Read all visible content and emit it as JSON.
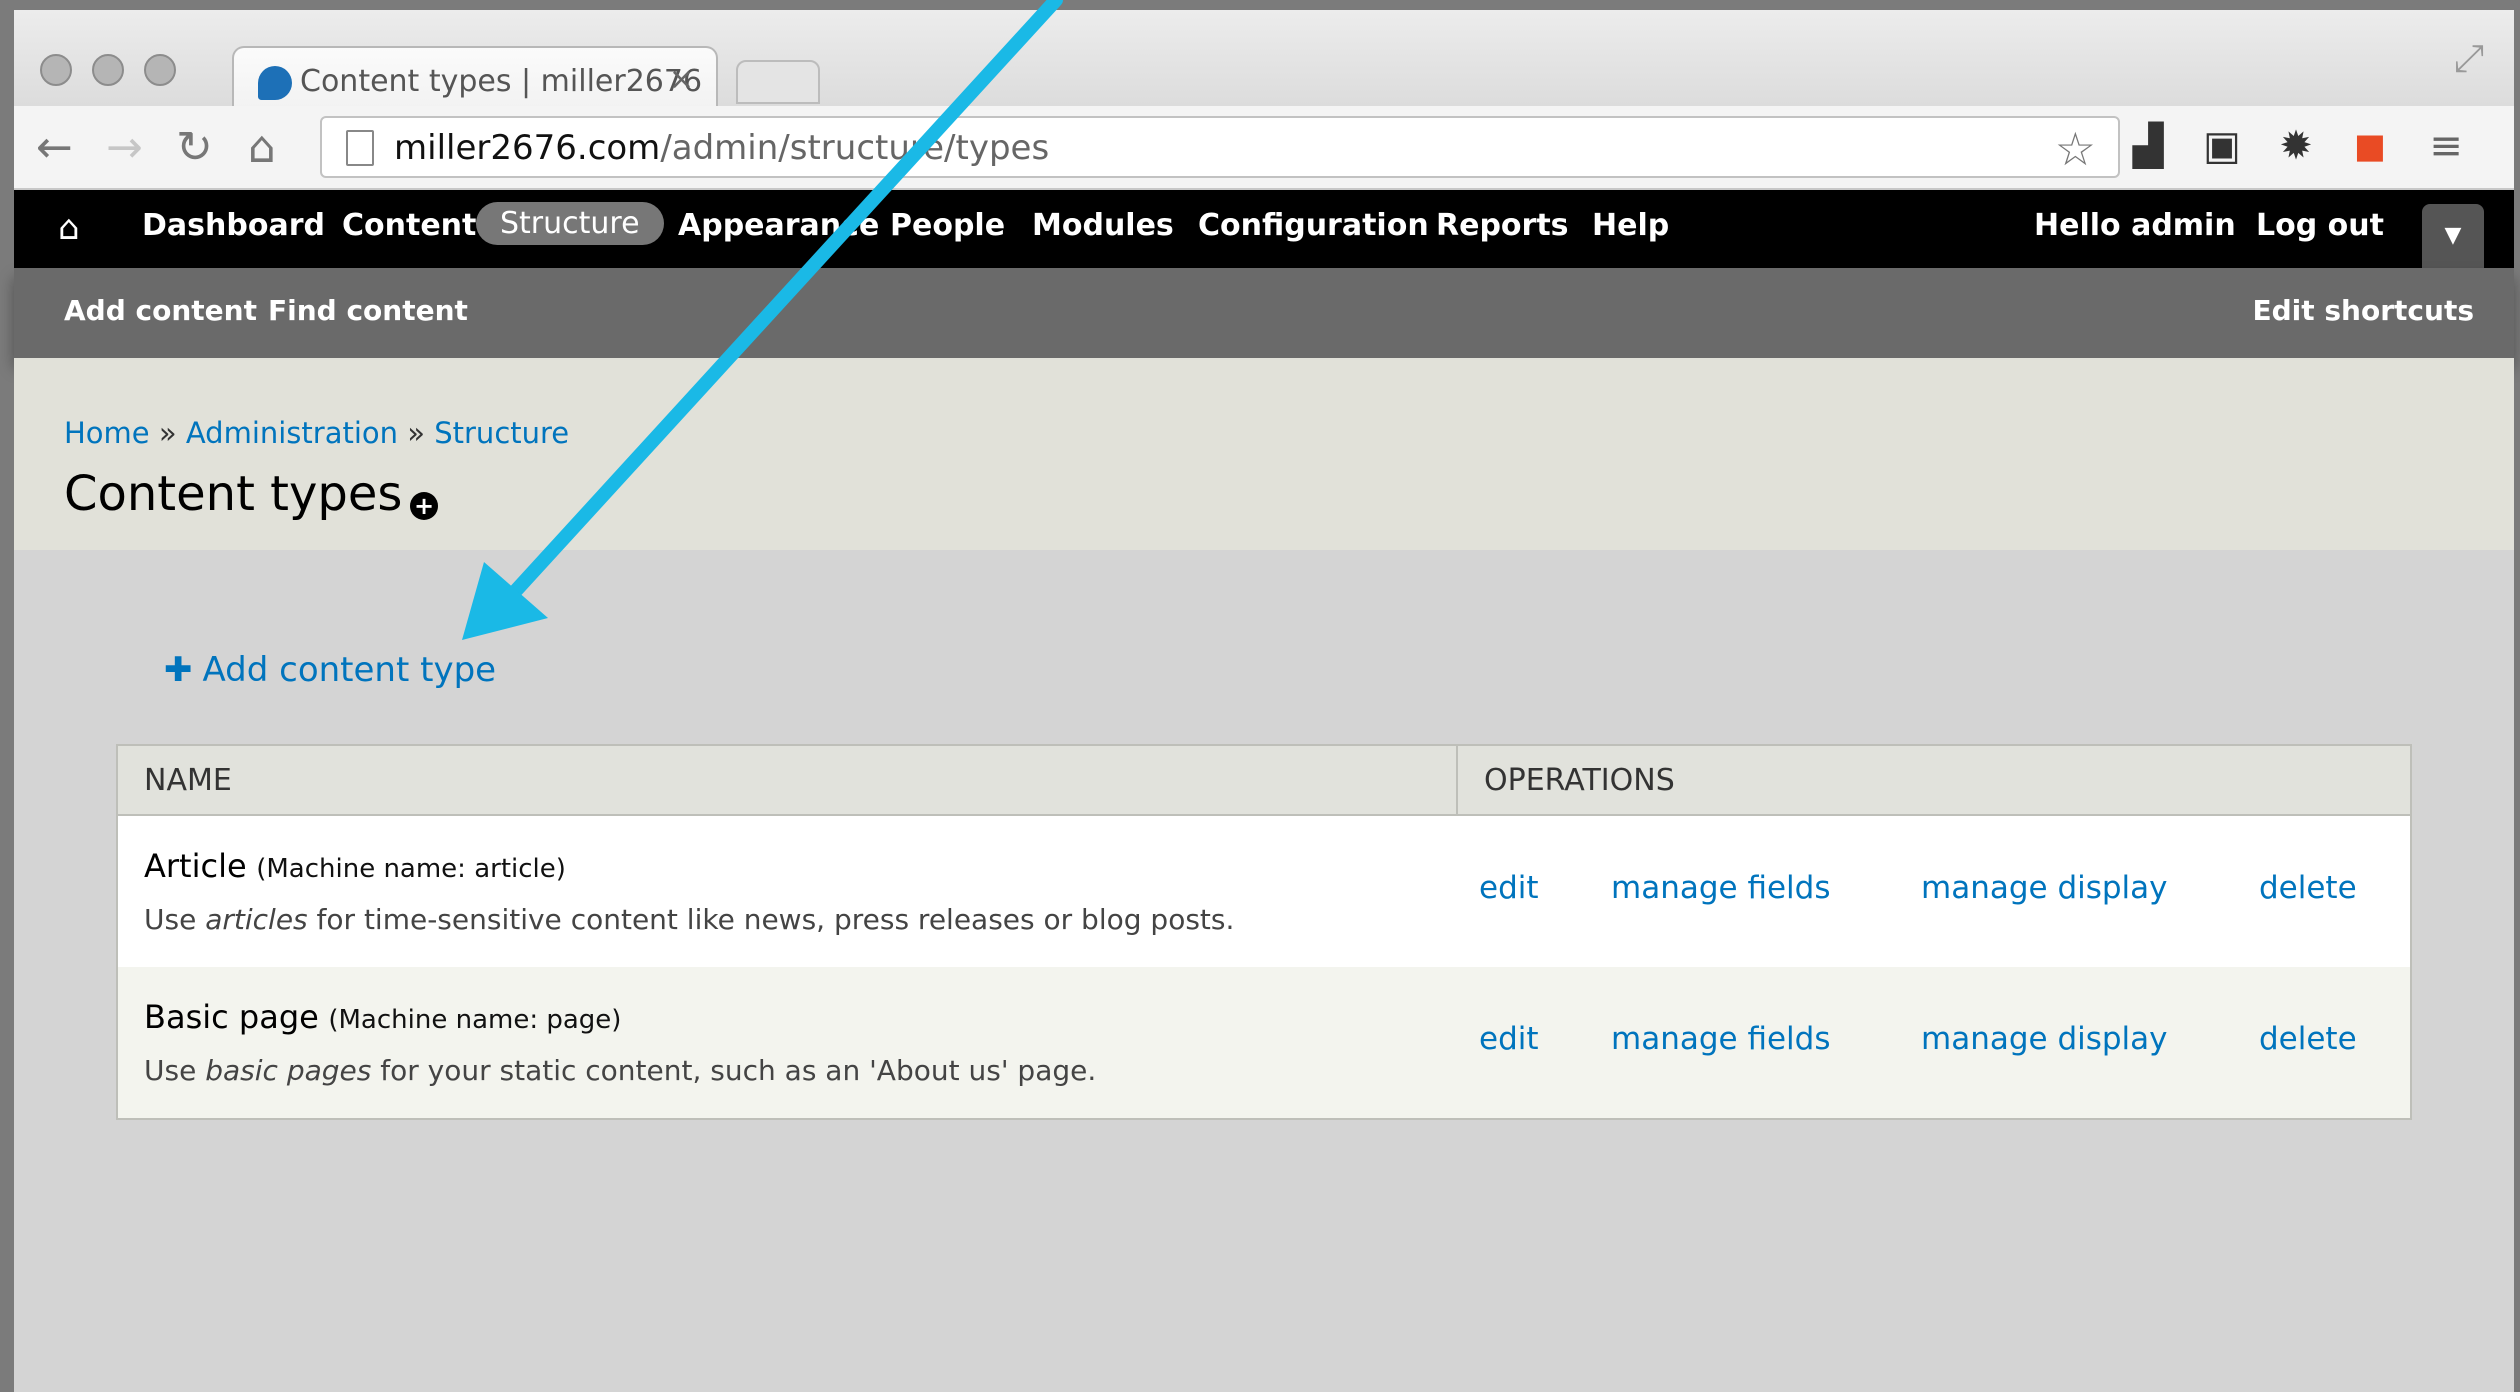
{
  "browser": {
    "tab_title": "Content types | miller2676",
    "tab_close": "×",
    "url_host": "miller2676.com",
    "url_path": "/admin/structure/types"
  },
  "admin_menu": {
    "items": [
      "Dashboard",
      "Content",
      "Structure",
      "Appearance",
      "People",
      "Modules",
      "Configuration",
      "Reports",
      "Help"
    ],
    "active": "Structure",
    "greeting_prefix": "Hello ",
    "user": "admin",
    "logout": "Log out"
  },
  "shortcuts": {
    "items": [
      "Add content",
      "Find content"
    ],
    "edit": "Edit shortcuts"
  },
  "header": {
    "breadcrumb": [
      "Home",
      "Administration",
      "Structure"
    ],
    "separator": "»",
    "title": "Content types"
  },
  "main": {
    "add_link": "Add content type",
    "table": {
      "columns": [
        "NAME",
        "OPERATIONS"
      ],
      "rows": [
        {
          "name": "Article",
          "machine": "(Machine name: article)",
          "desc_pre": "Use ",
          "desc_em": "articles",
          "desc_post": " for time-sensitive content like news, press releases or blog posts.",
          "ops": [
            "edit",
            "manage fields",
            "manage display",
            "delete"
          ]
        },
        {
          "name": "Basic page",
          "machine": "(Machine name: page)",
          "desc_pre": "Use ",
          "desc_em": "basic pages",
          "desc_post": " for your static content, such as an 'About us' page.",
          "ops": [
            "edit",
            "manage fields",
            "manage display",
            "delete"
          ]
        }
      ]
    }
  },
  "annotation": {
    "arrow_color": "#1ab9e6"
  }
}
